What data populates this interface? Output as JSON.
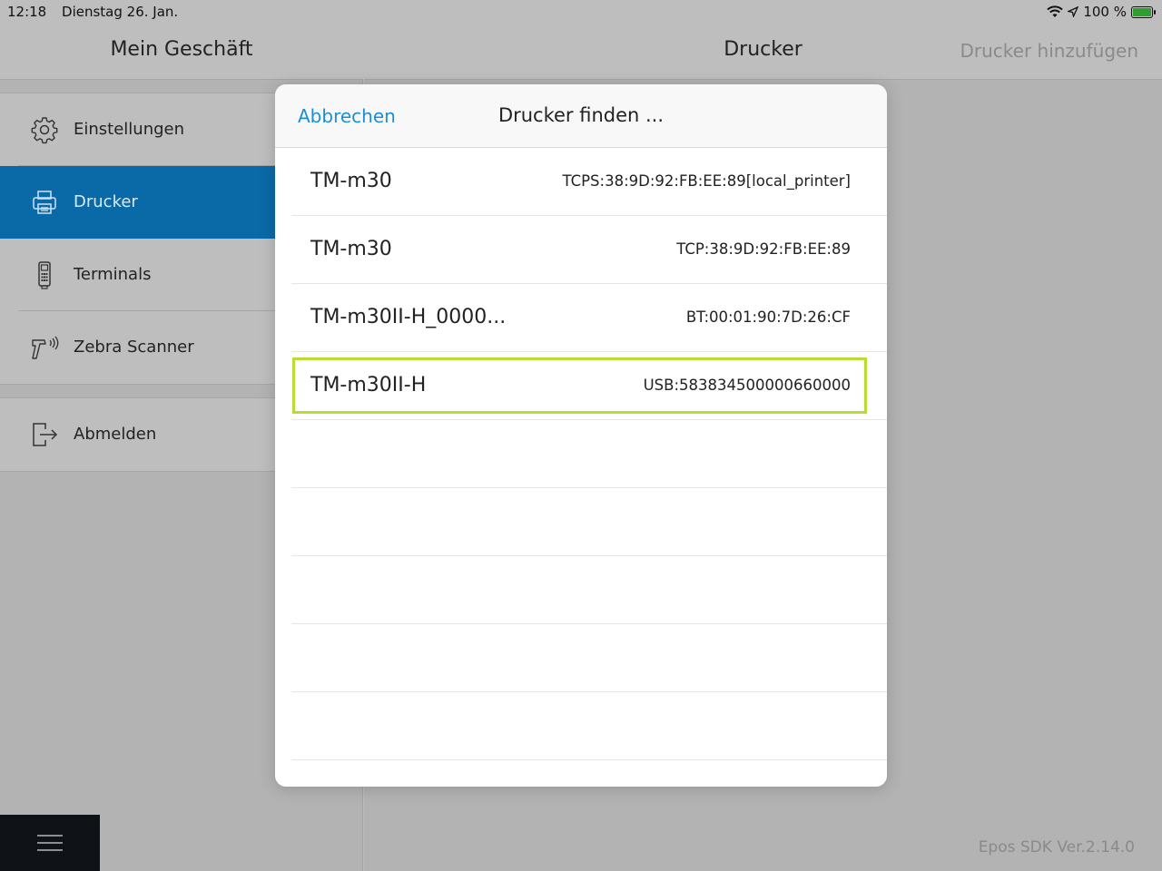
{
  "status_bar": {
    "time": "12:18",
    "date": "Dienstag 26. Jan.",
    "battery": "100 %",
    "icons": [
      "wifi-icon",
      "location-icon",
      "battery-charging-icon"
    ]
  },
  "sidebar": {
    "title": "Mein Geschäft",
    "items": [
      {
        "label": "Einstellungen",
        "icon": "gear-icon"
      },
      {
        "label": "Drucker",
        "icon": "printer-icon",
        "active": true
      },
      {
        "label": "Terminals",
        "icon": "payment-terminal-icon"
      },
      {
        "label": "Zebra Scanner",
        "icon": "barcode-scanner-icon"
      }
    ],
    "logout": {
      "label": "Abmelden",
      "icon": "logout-icon"
    },
    "menu_icon": "hamburger-menu-icon"
  },
  "main": {
    "title": "Drucker",
    "add_button": "Drucker hinzufügen",
    "version": "Epos SDK Ver.2.14.0"
  },
  "dialog": {
    "cancel_label": "Abbrechen",
    "title": "Drucker finden ...",
    "printers": [
      {
        "name": "TM-m30",
        "address": "TCPS:38:9D:92:FB:EE:89[local_printer]"
      },
      {
        "name": "TM-m30",
        "address": "TCP:38:9D:92:FB:EE:89"
      },
      {
        "name": "TM-m30II-H_0000...",
        "address": "BT:00:01:90:7D:26:CF"
      },
      {
        "name": "TM-m30II-H",
        "address": "USB:583834500000660000",
        "highlighted": true
      }
    ],
    "empty_rows": 5
  },
  "colors": {
    "accent": "#1a8fd6",
    "active_item": "#0a6aa8",
    "highlight": "#b7dc34"
  }
}
